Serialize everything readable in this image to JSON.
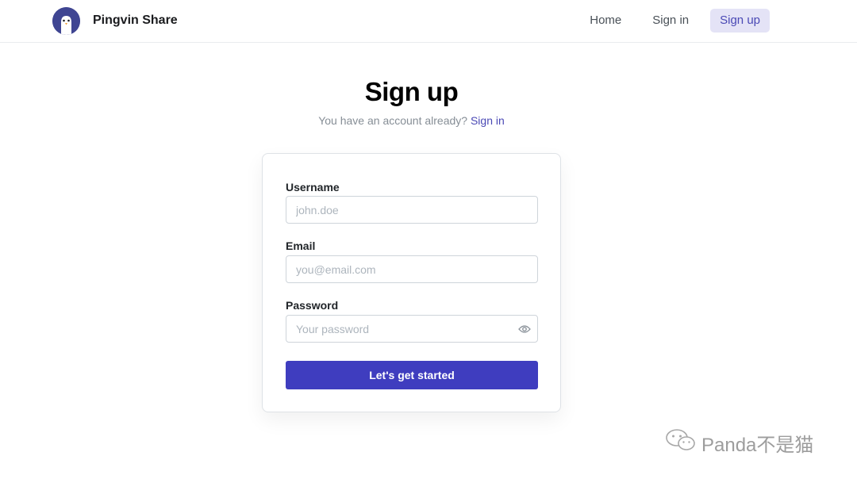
{
  "header": {
    "brand_name": "Pingvin Share",
    "nav": [
      {
        "label": "Home",
        "active": false
      },
      {
        "label": "Sign in",
        "active": false
      },
      {
        "label": "Sign up",
        "active": true
      }
    ]
  },
  "page": {
    "title": "Sign up",
    "subtitle_text": "You have an account already?",
    "subtitle_link": "Sign in"
  },
  "form": {
    "username": {
      "label": "Username",
      "placeholder": "john.doe",
      "value": ""
    },
    "email": {
      "label": "Email",
      "placeholder": "you@email.com",
      "value": ""
    },
    "password": {
      "label": "Password",
      "placeholder": "Your password",
      "value": ""
    },
    "submit_label": "Let's get started"
  },
  "watermark": {
    "text": "Panda不是猫"
  },
  "icons": {
    "logo": "penguin-logo-icon",
    "password_toggle": "eye-icon",
    "watermark": "wechat-icon"
  },
  "colors": {
    "accent": "#3f3dbf",
    "link": "#4a49b5",
    "active_nav_bg": "#e4e3f6",
    "logo_bg": "#3f4592"
  }
}
